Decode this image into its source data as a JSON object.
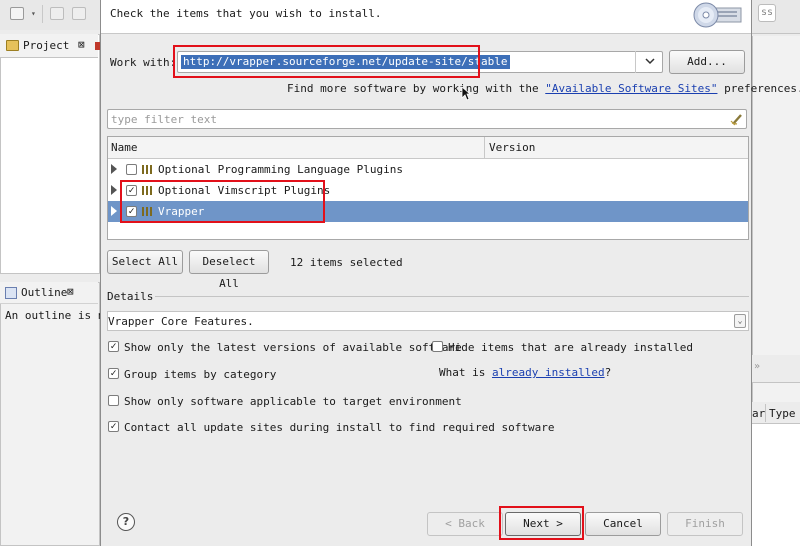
{
  "ide": {
    "project_tab": "Project",
    "outline_tab": "Outline",
    "outline_message": "An outline is no",
    "right_table_col1": "ar",
    "right_table_col2": "Type",
    "right_field_text": "ss"
  },
  "dialog": {
    "header_text": "Check the items that you wish to install.",
    "work_with_label": "Work with:",
    "work_with_url": "http://vrapper.sourceforge.net/update-site/stable",
    "add_button": "Add...",
    "find_more_prefix": "Find more software by working with the ",
    "find_more_link": "\"Available Software Sites\"",
    "find_more_suffix": " preferences.",
    "filter_placeholder": "type filter text",
    "columns": {
      "name": "Name",
      "version": "Version"
    },
    "items": [
      {
        "name": "Optional Programming Language Plugins",
        "checked": false,
        "selected": false
      },
      {
        "name": "Optional Vimscript Plugins",
        "checked": true,
        "selected": false
      },
      {
        "name": "Vrapper",
        "checked": true,
        "selected": true
      }
    ],
    "select_all": "Select All",
    "deselect_all": "Deselect All",
    "selected_count": "12 items selected",
    "details_label": "Details",
    "details_text": "Vrapper Core Features.",
    "opt_latest": "Show only the latest versions of available software",
    "opt_hide_installed": "Hide items that are already installed",
    "opt_group": "Group items by category",
    "what_is_prefix": "What is ",
    "what_is_link": "already installed",
    "what_is_suffix": "?",
    "opt_applicable": "Show only software applicable to target environment",
    "opt_contact": "Contact all update sites during install to find required software",
    "back_button": "< Back",
    "next_button": "Next >",
    "cancel_button": "Cancel",
    "finish_button": "Finish"
  },
  "checkbox_states": {
    "opt_latest": true,
    "opt_hide_installed": false,
    "opt_group": true,
    "opt_applicable": false,
    "opt_contact": true
  },
  "colors": {
    "highlight": "#e2101a",
    "selection": "#6f95c8",
    "link": "#1a3fb0"
  }
}
